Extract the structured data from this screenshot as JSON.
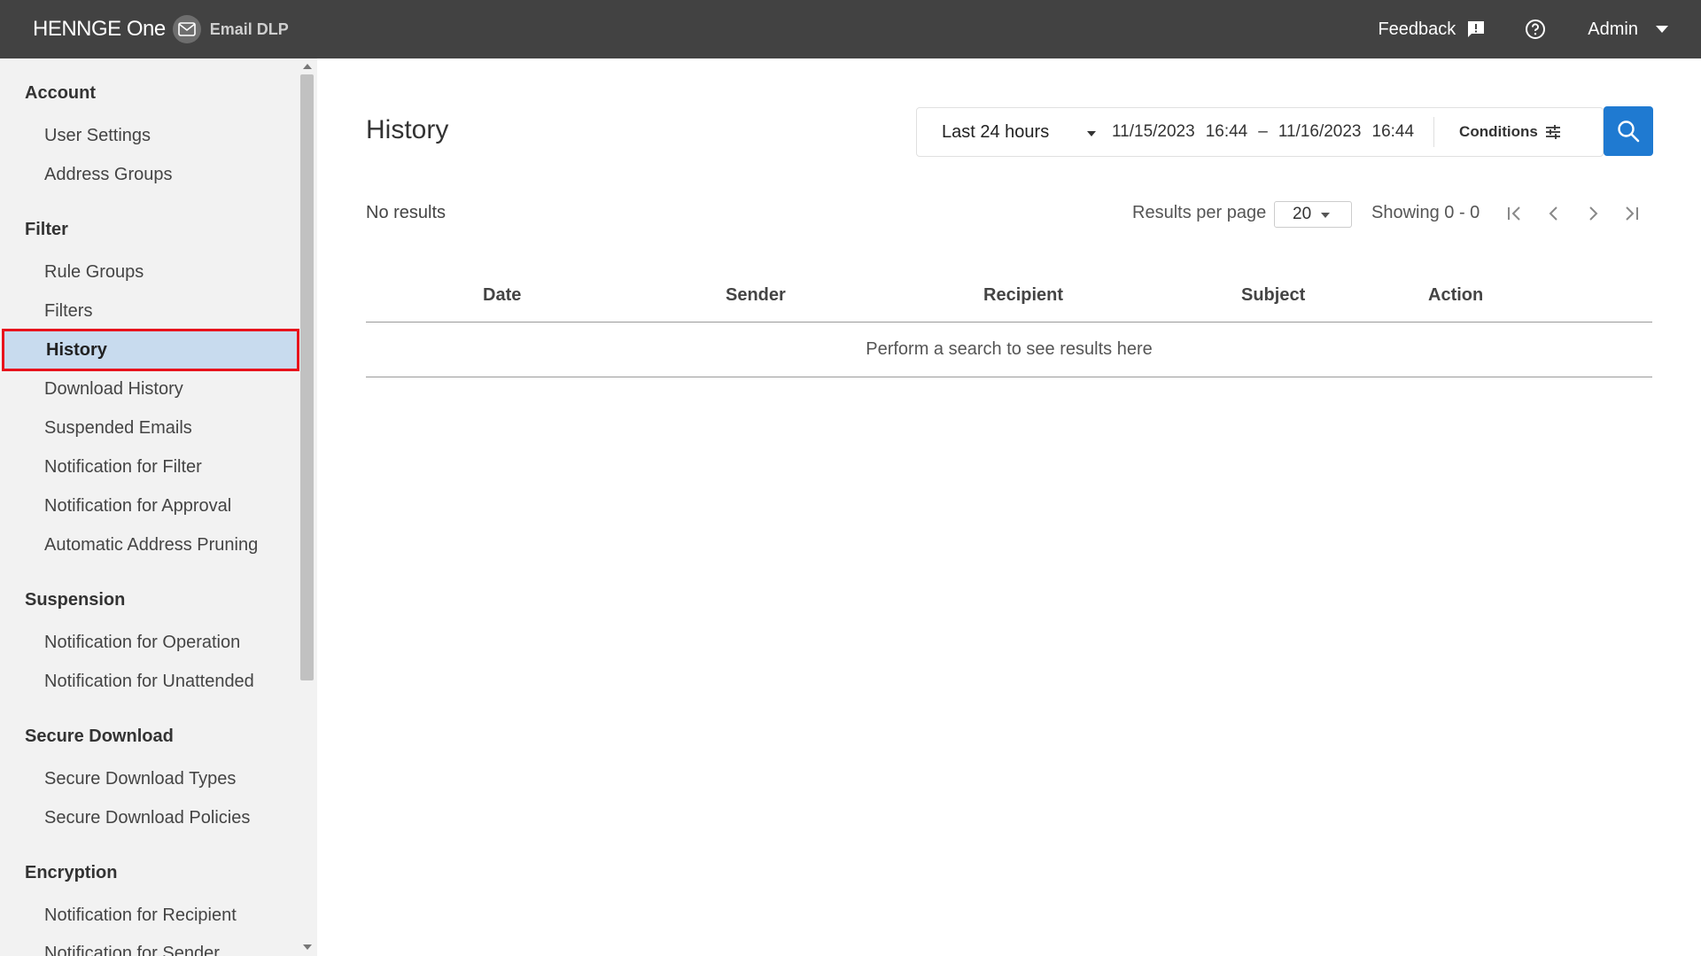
{
  "header": {
    "brand": "HENNGE One",
    "product": "Email DLP",
    "feedback_label": "Feedback",
    "user_label": "Admin",
    "icons": [
      "mail-icon",
      "feedback-icon",
      "help-icon",
      "chevron-down-icon"
    ]
  },
  "sidebar": {
    "sections": [
      {
        "title": "Account",
        "items": [
          "User Settings",
          "Address Groups"
        ]
      },
      {
        "title": "Filter",
        "items": [
          "Rule Groups",
          "Filters",
          "History",
          "Download History",
          "Suspended Emails",
          "Notification for Filter",
          "Notification for Approval",
          "Automatic Address Pruning"
        ]
      },
      {
        "title": "Suspension",
        "items": [
          "Notification for Operation",
          "Notification for Unattended"
        ]
      },
      {
        "title": "Secure Download",
        "items": [
          "Secure Download Types",
          "Secure Download Policies"
        ]
      },
      {
        "title": "Encryption",
        "items": [
          "Notification for Recipient",
          "Notification for Sender"
        ]
      }
    ],
    "active_item": "History"
  },
  "main": {
    "title": "History",
    "range_option": "Last 24 hours",
    "from_date": "11/15/2023",
    "from_time": "16:44",
    "dash": "–",
    "to_date": "11/16/2023",
    "to_time": "16:44",
    "conditions_label": "Conditions",
    "no_results": "No results",
    "results_per_page_label": "Results per page",
    "results_per_page_value": "20",
    "showing": "Showing 0 - 0",
    "columns": [
      "Date",
      "Sender",
      "Recipient",
      "Subject",
      "Action"
    ],
    "empty_message": "Perform a search to see results here"
  },
  "colors": {
    "header_bg": "#424242",
    "sidebar_bg": "#f2f2f2",
    "active_bg": "#c8dbee",
    "active_border": "#e8131c",
    "search_button": "#1f7ad1"
  }
}
